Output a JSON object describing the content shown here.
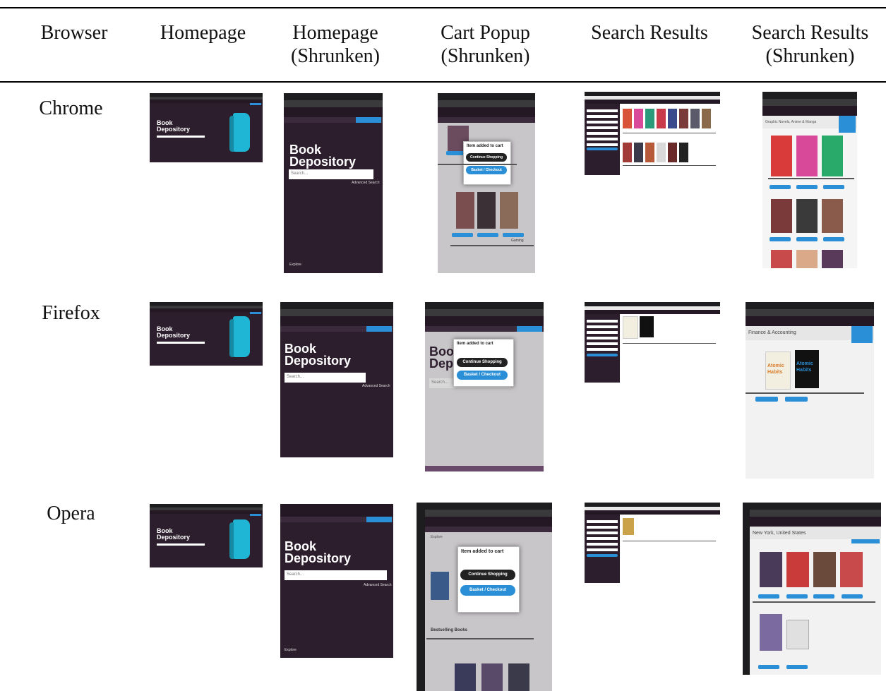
{
  "headers": {
    "browser": "Browser",
    "homepage": "Homepage",
    "homepage_shrunken": "Homepage (Shrunken)",
    "cart_popup_shrunken": "Cart Popup (Shrunken)",
    "search_results": "Search Results",
    "search_results_shrunken": "Search Results (Shrunken)"
  },
  "rows": [
    {
      "browser": "Chrome"
    },
    {
      "browser": "Firefox"
    },
    {
      "browser": "Opera"
    }
  ],
  "shot_text": {
    "site_title": "Book Depository",
    "search_placeholder": "Search...",
    "advanced_search": "Advanced Search",
    "item_added": "Item added to cart",
    "continue_shopping": "Continue Shopping",
    "basket_checkout": "Basket / Checkout",
    "gaming": "Gaming",
    "bestselling": "Bestselling Books",
    "explore": "Explore",
    "chrome_category": "Graphic Novels, Anime & Manga",
    "firefox_category": "Finance & Accounting",
    "opera_category": "New York, United States",
    "atomic": "Atomic",
    "habits": "Habits"
  },
  "colors": {
    "site_dark": "#2d1e2e",
    "accent_blue": "#2a8fd6",
    "book_cyan": "#1fb5d4",
    "light_bg": "#f2f2f2"
  }
}
